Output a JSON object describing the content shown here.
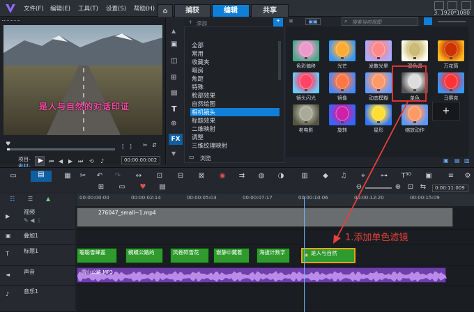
{
  "menu": [
    "文件(F)",
    "编辑(E)",
    "工具(T)",
    "设置(S)",
    "帮助(H)"
  ],
  "tabs": {
    "home_icon": "home-icon",
    "capture": "捕获",
    "edit": "编辑",
    "share": "共享"
  },
  "resolution": "3. 1920*1080",
  "preview": {
    "subtitle": "是人与自然的对话印证",
    "project_label": "项目-",
    "clip_label": "素材-",
    "timecode": "00:00:00:002"
  },
  "library": {
    "add_label": "添加",
    "browse_label": "浏览",
    "categories": [
      "全部",
      "常用",
      "收藏夹",
      "暗房",
      "焦距",
      "特殊",
      "脸部效果",
      "自然绘图",
      "相机镜头",
      "标题效果",
      "二维映射",
      "调整",
      "三维纹理映射"
    ],
    "selected_category": "相机镜头",
    "search_placeholder": "搜索当前视图"
  },
  "filters": [
    {
      "label": "色彩偏移"
    },
    {
      "label": "光芒"
    },
    {
      "label": "发散光晕"
    },
    {
      "label": "双色调"
    },
    {
      "label": "万花筒"
    },
    {
      "label": "镜头闪光"
    },
    {
      "label": "镜像"
    },
    {
      "label": "动态模糊"
    },
    {
      "label": "单色"
    },
    {
      "label": "马赛克"
    },
    {
      "label": "老电影"
    },
    {
      "label": "旋转"
    },
    {
      "label": "星形"
    },
    {
      "label": "缩放动作"
    }
  ],
  "timeline": {
    "timecodes": [
      "00:00:00:00",
      "00:00:02:14",
      "00:00:05:03",
      "00:00:07:17",
      "00:00:10:06",
      "00:00:12:20",
      "00:00:15:09"
    ],
    "zoom_timecode": "0:00:11:009",
    "tracks": [
      {
        "name": "视频"
      },
      {
        "name": "叠加1"
      },
      {
        "name": "标题1"
      },
      {
        "name": "声音"
      },
      {
        "name": "音乐1"
      }
    ],
    "video_clip": "276047_small~1.mp4",
    "title_clips": [
      "聪聪雪峰盖",
      "蜿蜒公路的",
      "风卷碎雪花",
      "嵌静中藏着",
      "海拔计数字",
      "是人与自然"
    ],
    "audio_clip": "雪山公路.MP3"
  },
  "annotation": "1.添加单色滤镜"
}
